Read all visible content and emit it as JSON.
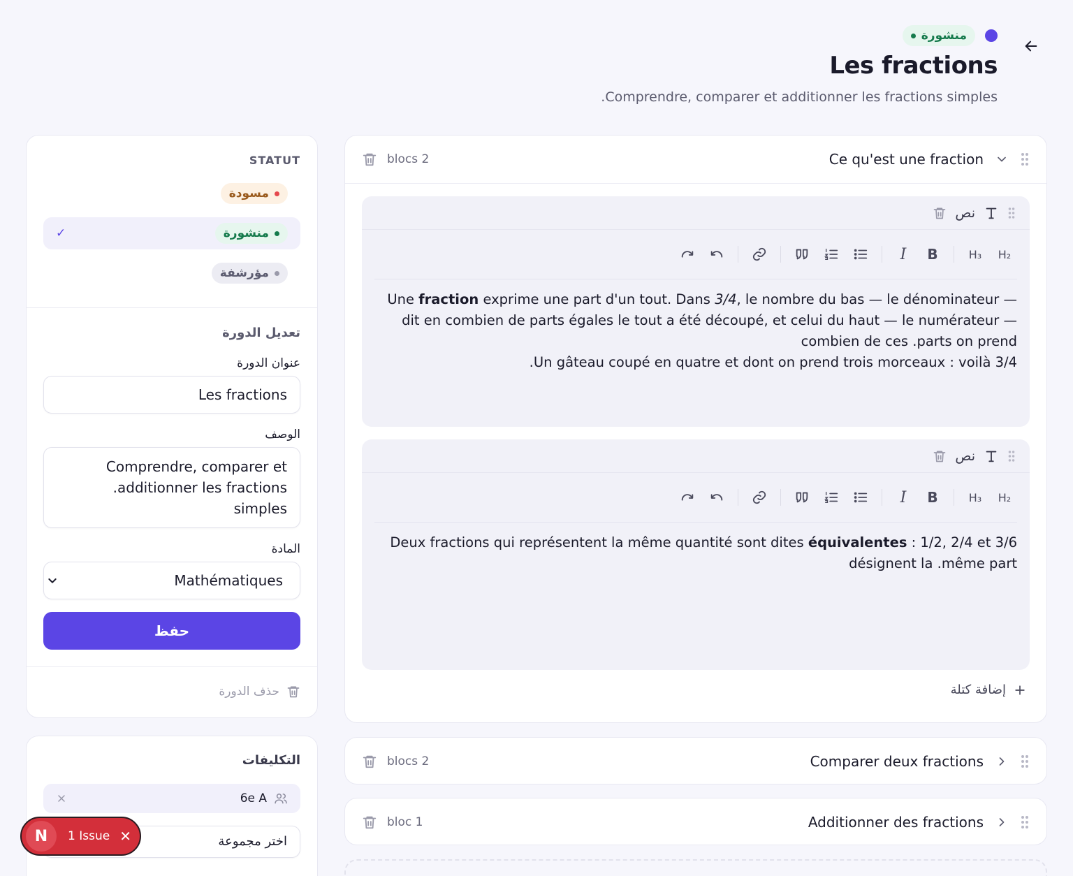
{
  "header": {
    "status_label": "منشورة",
    "title": "Les fractions",
    "description": ".Comprendre, comparer et additionner les fractions simples"
  },
  "sidebar": {
    "status_heading": "STATUT",
    "statuses": [
      {
        "label": "مسودة"
      },
      {
        "label": "منشورة",
        "selected": true
      },
      {
        "label": "مؤرشفة"
      }
    ],
    "check_mark": "✓",
    "form_heading": "تعديل الدورة",
    "title_label": "عنوان الدورة",
    "title_value": "Les fractions",
    "description_label": "الوصف",
    "description_line1": "Comprendre, comparer et",
    "description_line2": ".additionner les fractions simples",
    "subject_label": "المادة",
    "subject_value": "Mathématiques",
    "save_label": "حفظ",
    "delete_label": "حذف الدورة"
  },
  "assignments": {
    "heading": "التكليفات",
    "group_name": "6e A",
    "select_placeholder": "اختر مجموعة"
  },
  "sections": [
    {
      "title": "Ce qu'est une fraction",
      "count": "blocs 2",
      "expanded": true,
      "blocks": [
        {
          "type": "نص",
          "paragraph1_a": "Une ",
          "paragraph1_bold": "fraction",
          "paragraph1_b": " exprime une part d'un tout. Dans ",
          "paragraph1_italic": "3/4",
          "paragraph1_c": ", le nombre du bas — le dénominateur — dit en combien de parts égales le tout a été découpé, et celui du haut — le numérateur — combien de ces .parts on prend",
          "paragraph2": ".Un gâteau coupé en quatre et dont on prend trois morceaux : voilà 3/4"
        },
        {
          "type": "نص",
          "paragraph1_a": "Deux fractions qui représentent la même quantité sont dites ",
          "paragraph1_bold": "équivalentes",
          "paragraph1_b": " : 1/2, 2/4 et 3/6 désignent la .même part"
        }
      ],
      "add_block_label": "إضافة كتلة"
    },
    {
      "title": "Comparer deux fractions",
      "count": "blocs 2"
    },
    {
      "title": "Additionner des fractions",
      "count": "bloc 1"
    }
  ],
  "toolbar": {
    "h2": "H₂",
    "h3": "H₃",
    "bold": "B",
    "italic": "I"
  },
  "toast": {
    "badge": "N",
    "label": "1 Issue",
    "close": "✕"
  },
  "colors": {
    "accent": "#5b45e5",
    "published": "#157a4c",
    "draft_dot": "#e5484d",
    "toast": "#d32f3a"
  }
}
